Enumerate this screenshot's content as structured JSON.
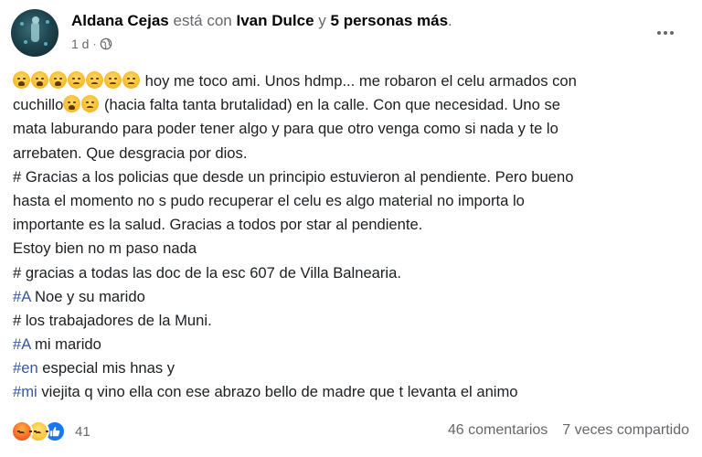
{
  "header": {
    "author": "Aldana Cejas",
    "with_text": "está con",
    "tagged_person": "Ivan Dulce",
    "and_text": "y",
    "others_text": "5 personas más",
    "period": ".",
    "time": "1 d",
    "separator": "·",
    "audience_icon": "globe-icon",
    "more_icon": "more-options-icon"
  },
  "body": {
    "line1": "hoy me toco ami. Unos hdmp... me robaron el celu armados con",
    "line2a": "cuchillo",
    "line2b": "(hacia falta tanta brutalidad) en la calle. Con que necesidad. Uno se",
    "line3": "mata laburando para poder tener algo y para que otro venga como si nada y te lo",
    "line4": "arrebaten. Que desgracia por dios.",
    "line5": "# Gracias a los policias que desde un principio estuvieron al pendiente. Pero bueno",
    "line6": "hasta el momento no s pudo recuperar el celu es algo material no importa lo",
    "line7": "importante es la salud. Gracias a todos por star al pendiente.",
    "line8": "Estoy bien no m paso nada",
    "line9": "# gracias a todas las doc de la esc 607 de Villa Balnearia.",
    "line10_tag": "#A",
    "line10": " Noe y su marido",
    "line11": "# los trabajadores de la Muni.",
    "line12_tag": "#A",
    "line12": " mi marido",
    "line13_tag": "#en",
    "line13": " especial mis hnas y",
    "line14_tag": "#mi",
    "line14": " viejita q vino ella con ese abrazo bello de madre que t levanta el animo"
  },
  "footer": {
    "reaction_icons": [
      "angry-reaction-icon",
      "sad-reaction-icon",
      "like-reaction-icon"
    ],
    "reaction_count": "41",
    "comments": "46 comentarios",
    "shares": "7 veces compartido"
  },
  "colors": {
    "hashtag": "#385898",
    "muted": "#65676b",
    "like_blue": "#1877f2"
  }
}
